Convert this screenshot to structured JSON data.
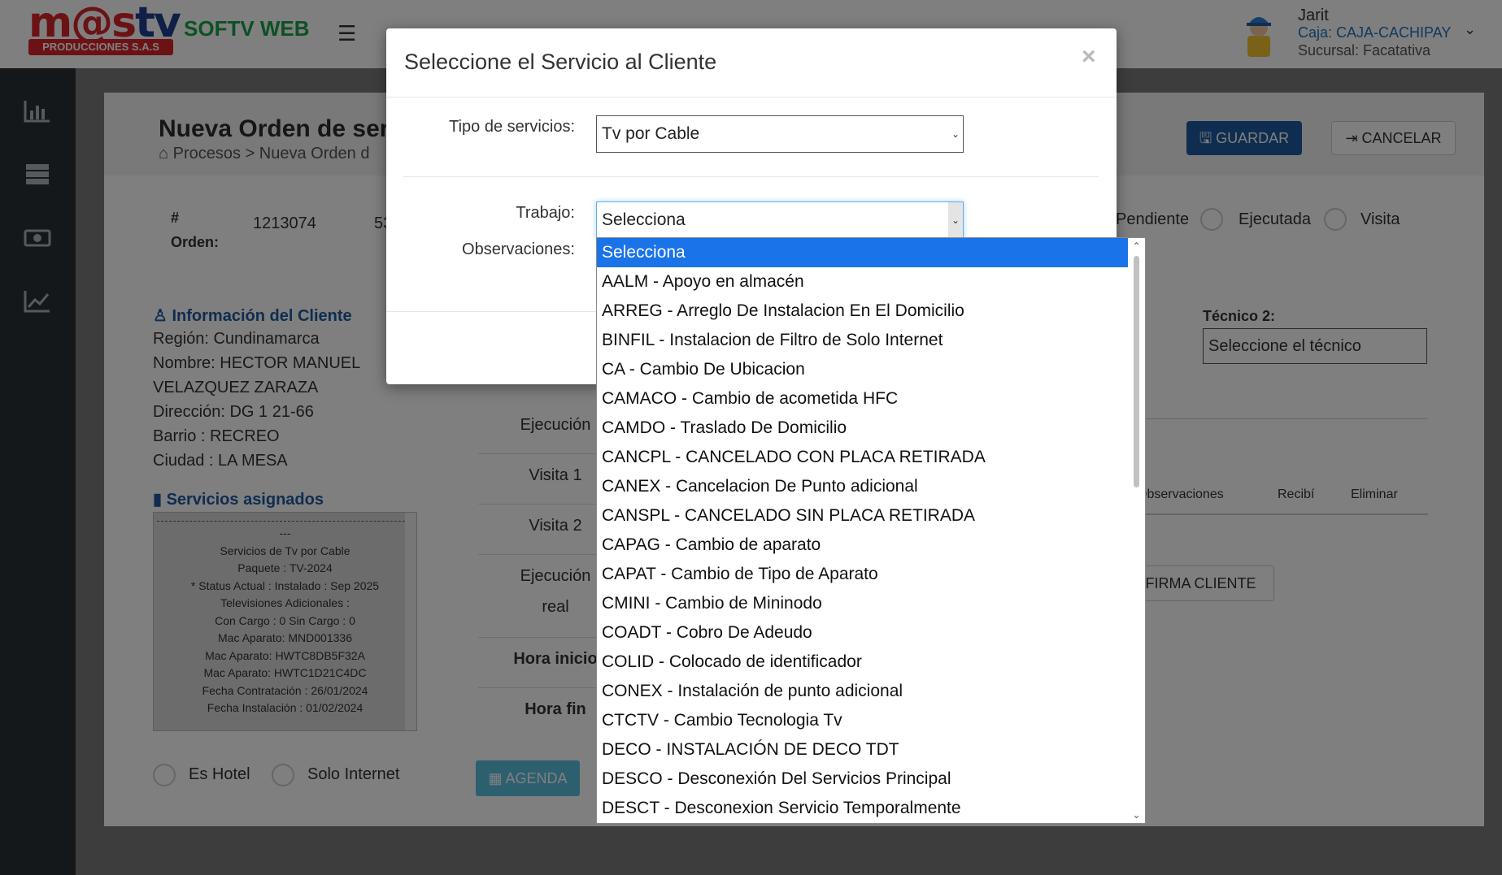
{
  "header": {
    "logo_main_a": "m@s",
    "logo_main_b": "tv",
    "logo_sub": "PRODUCCIONES S.A.S",
    "app_name": "SOFTV WEB",
    "user": {
      "name": "Jarit",
      "caja": "Caja: CAJA-CACHIPAY",
      "sucursal": "Sucursal: Facatativa"
    }
  },
  "sidebar": {
    "icons": [
      "bar-chart-icon",
      "server-icon",
      "money-icon",
      "line-chart-icon"
    ]
  },
  "page": {
    "title": "Nueva Orden de ser",
    "breadcrumb": "Procesos > Nueva Orden d",
    "save_label": "GUARDAR",
    "cancel_label": "CANCELAR",
    "order_hash": "#",
    "order_label": "Orden:",
    "order_number": "1213074",
    "order_partial": "53",
    "status_options": [
      "Pendiente",
      "Ejecutada",
      "Visita"
    ],
    "client_info_title": "Información del Cliente",
    "client_lines": [
      "Región: Cundinamarca",
      "Nombre: HECTOR MANUEL",
      "VELAZQUEZ ZARAZA",
      "Dirección: DG 1 21-66",
      "Barrio : RECREO",
      "Ciudad : LA MESA"
    ],
    "services_title": "Servicios asignados",
    "services_lines": [
      "---",
      "Servicios de Tv por Cable",
      "Paquete : TV-2024",
      "* Status Actual : Instalado : Sep 2025",
      "Televisiones Adicionales :",
      "Con Cargo : 0 Sin Cargo : 0",
      "Mac Aparato: MND001336",
      "Mac Aparato: HWTC8DB5F32A",
      "Mac Aparato: HWTC1D21C4DC",
      "Fecha Contratación : 26/01/2024",
      "Fecha Instalación : 01/02/2024"
    ],
    "checkbox_hotel": "Es Hotel",
    "checkbox_internet": "Solo Internet",
    "schedule_rows": [
      "Ejecución",
      "Visita 1",
      "Visita 2",
      "Ejecución",
      "real",
      "Hora inicio",
      "Hora fin"
    ],
    "agenda_label": "AGENDA",
    "tecnico2_label": "Técnico 2:",
    "tecnico2_value": "Seleccione el técnico",
    "table_headers": [
      "Observaciones",
      "Recibí",
      "Eliminar"
    ],
    "firma_label": "FIRMA CLIENTE"
  },
  "modal": {
    "title": "Seleccione el Servicio al Cliente",
    "close": "×",
    "tipo_label": "Tipo de servicios:",
    "tipo_value": "Tv por Cable",
    "trabajo_label": "Trabajo:",
    "trabajo_value": "Selecciona",
    "obs_label": "Observaciones:"
  },
  "dropdown": {
    "options": [
      "Selecciona",
      "AALM - Apoyo en almacén",
      "ARREG - Arreglo De Instalacion En El Domicilio",
      "BINFIL - Instalacion de Filtro de Solo Internet",
      "CA - Cambio De Ubicacion",
      "CAMACO - Cambio de acometida HFC",
      "CAMDO - Traslado De Domicilio",
      "CANCPL - CANCELADO CON PLACA RETIRADA",
      "CANEX - Cancelacion De Punto adicional",
      "CANSPL - CANCELADO SIN PLACA RETIRADA",
      "CAPAG - Cambio de aparato",
      "CAPAT - Cambio de Tipo de Aparato",
      "CMINI - Cambio de Mininodo",
      "COADT - Cobro De Adeudo",
      "COLID - Colocado de identificador",
      "CONEX - Instalación de punto adicional",
      "CTCTV - Cambio Tecnologia Tv",
      "DECO - INSTALACIÓN DE DECO TDT",
      "DESCO - Desconexión Del Servicios Principal",
      "DESCT - Desconexion Servicio Temporalmente"
    ],
    "selected_index": 0,
    "selected_color": "#1a73e8"
  }
}
